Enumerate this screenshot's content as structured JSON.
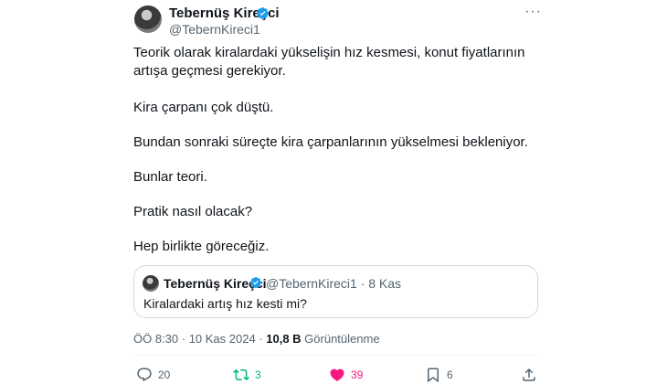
{
  "author": {
    "name": "Tebernüş Kireçci",
    "handle": "@TebernKireci1"
  },
  "tweet": {
    "lines": [
      "Teorik olarak kiralardaki yükselişin hız kesmesi, konut fiyatlarının artışa geçmesi gerekiyor.",
      "Kira çarpanı çok düştü.",
      "Bundan sonraki süreçte kira çarpanlarının yükselmesi bekleniyor.",
      "Bunlar teori.",
      "Pratik nasıl olacak?",
      "Hep birlikte göreceğiz."
    ]
  },
  "quoted": {
    "name": "Tebernüş Kireçci",
    "handle_date": "@TebernKireci1 · 8 Kas",
    "text": "Kiralardaki artış hız kesti mi?"
  },
  "meta": {
    "time_date": "ÖÖ 8:30 · 10 Kas 2024 · ",
    "views": "10,8 B",
    "views_label": " Görüntülenme"
  },
  "actions": {
    "replies": "20",
    "reposts": "3",
    "likes": "39",
    "bookmarks": "6"
  },
  "colors": {
    "verified": "#1d9bf0",
    "repost": "#00ba7c",
    "like": "#f91880",
    "muted": "#536471"
  },
  "icons": [
    "verified-badge-icon",
    "more-icon",
    "reply-icon",
    "repost-icon",
    "like-icon",
    "bookmark-icon",
    "share-icon"
  ]
}
